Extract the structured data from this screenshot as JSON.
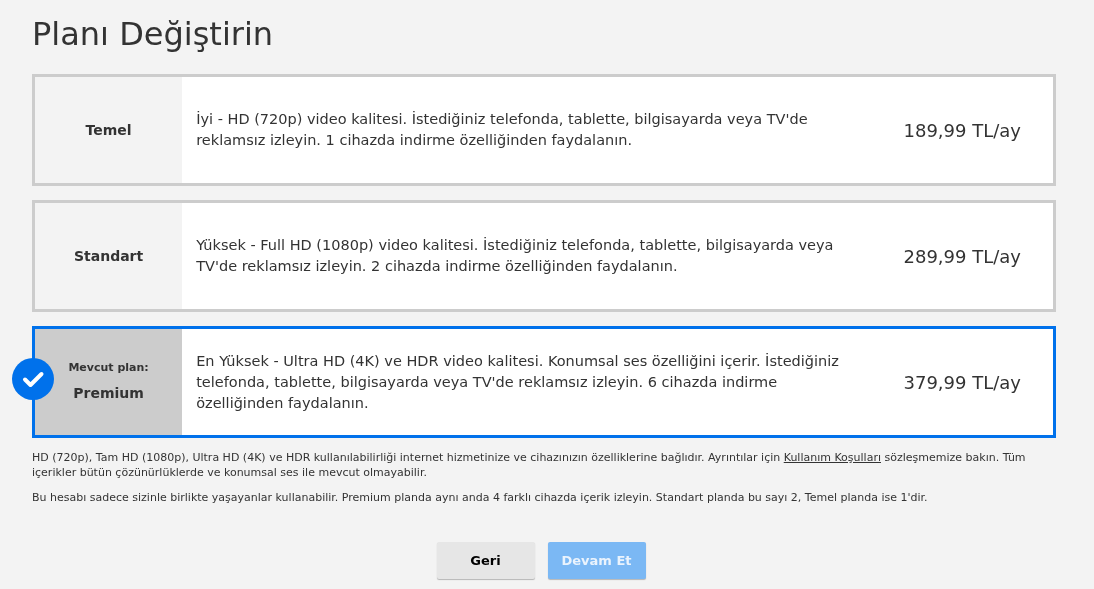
{
  "title": "Planı Değiştirin",
  "plans": [
    {
      "name": "Temel",
      "description": "İyi - HD (720p) video kalitesi. İstediğiniz telefonda, tablette, bilgisayarda veya TV'de reklamsız izleyin. 1 cihazda indirme özelliğinden faydalanın.",
      "price": "189,99 TL/ay",
      "selected": false
    },
    {
      "name": "Standart",
      "description": "Yüksek - Full HD (1080p) video kalitesi. İstediğiniz telefonda, tablette, bilgisayarda veya TV'de reklamsız izleyin. 2 cihazda indirme özelliğinden faydalanın.",
      "price": "289,99 TL/ay",
      "selected": false
    },
    {
      "name": "Premium",
      "current_label": "Mevcut plan:",
      "description": "En Yüksek - Ultra HD (4K) ve HDR video kalitesi. Konumsal ses özelliğini içerir. İstediğiniz telefonda, tablette, bilgisayarda veya TV'de reklamsız izleyin. 6 cihazda indirme özelliğinden faydalanın.",
      "price": "379,99 TL/ay",
      "selected": true
    }
  ],
  "note": {
    "before": "HD (720p), Tam HD (1080p), Ultra HD (4K) ve HDR kullanılabilirliği internet hizmetinize ve cihazınızın özelliklerine bağlıdır. Ayrıntılar için ",
    "link": "Kullanım Koşulları",
    "after": " sözleşmemize bakın. Tüm içerikler bütün çözünürlüklerde ve konumsal ses ile mevcut olmayabilir."
  },
  "note2": "Bu hesabı sadece sizinle birlikte yaşayanlar kullanabilir. Premium planda aynı anda 4 farklı cihazda içerik izleyin. Standart planda bu sayı 2, Temel planda ise 1'dir.",
  "buttons": [
    {
      "label": "Geri",
      "kind": "secondary",
      "disabled": false
    },
    {
      "label": "Devam Et",
      "kind": "primary",
      "disabled": true
    }
  ]
}
